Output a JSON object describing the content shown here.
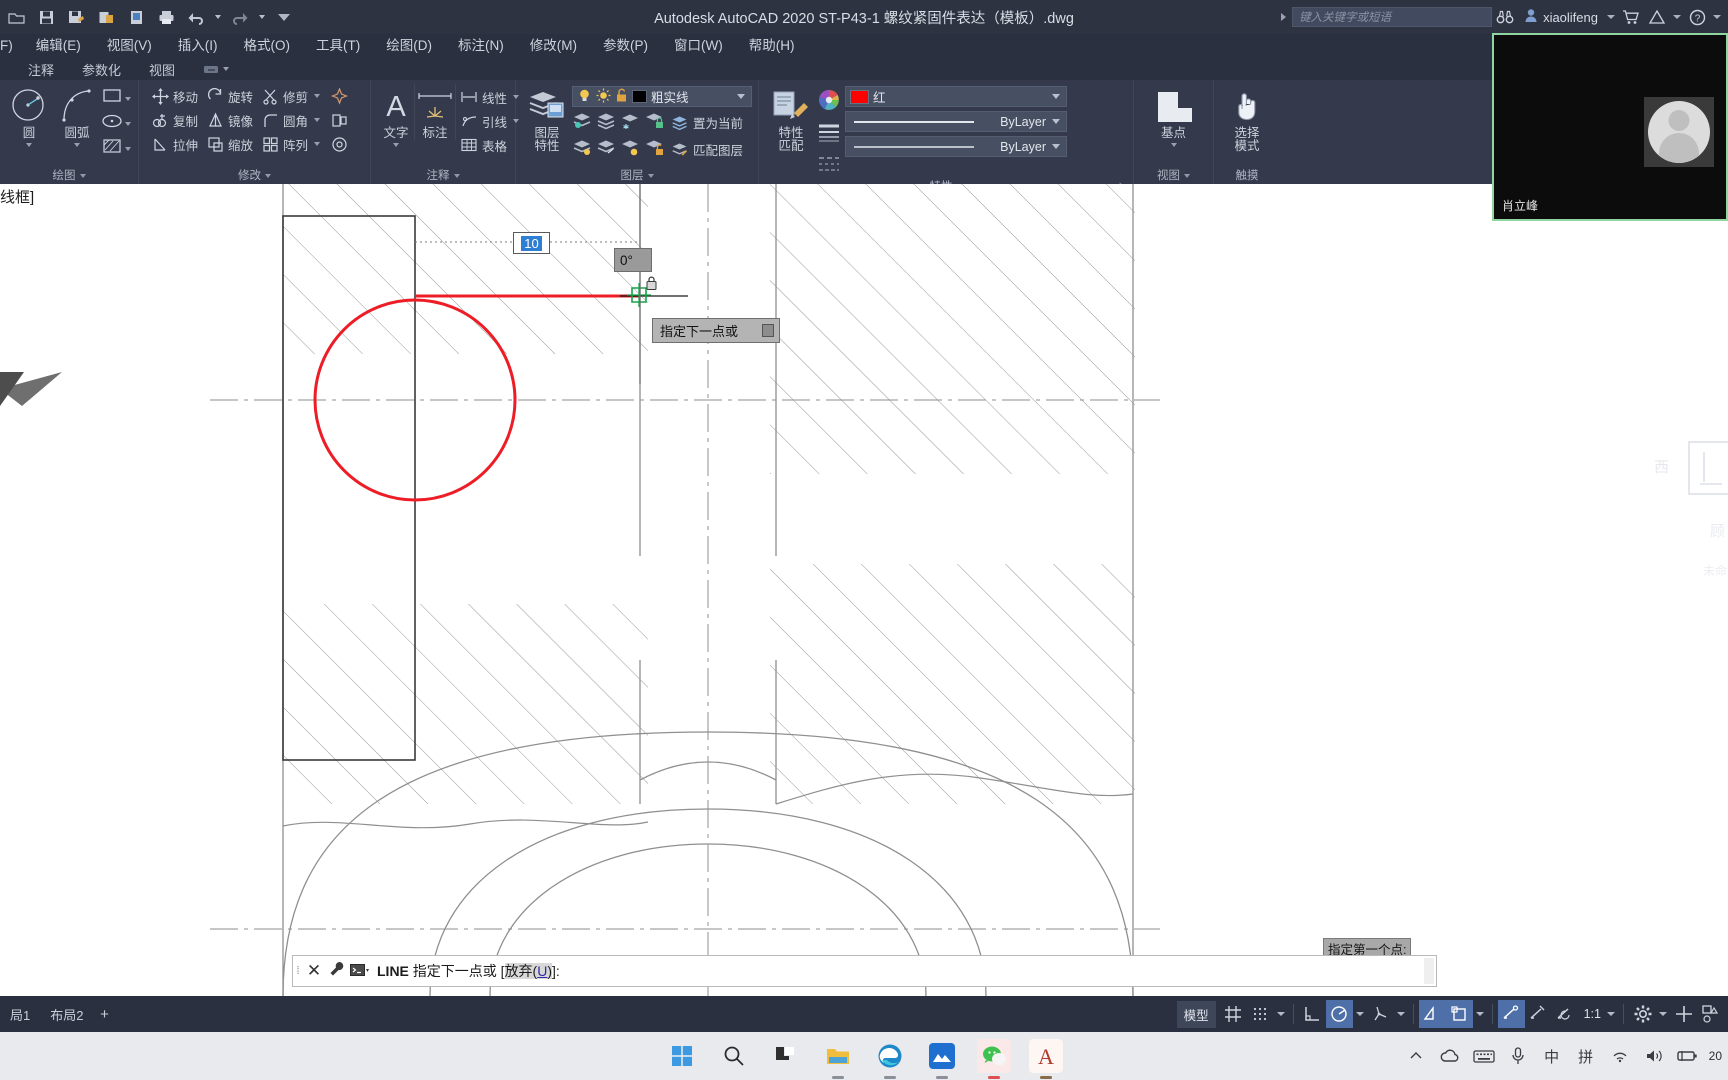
{
  "window": {
    "title": "Autodesk AutoCAD 2020   ST-P43-1 螺纹紧固件表达（模板）.dwg",
    "app": "Autodesk AutoCAD 2020",
    "document": "ST-P43-1 螺纹紧固件表达（模板）.dwg"
  },
  "quick_access": {
    "icons": [
      "open-icon",
      "save-icon",
      "save-as-icon",
      "export-icon",
      "plot-preview-icon",
      "print-icon",
      "undo-icon",
      "redo-icon",
      "customize-icon"
    ]
  },
  "titlebar_right": {
    "search_placeholder": "键入关键字或短语",
    "search_icon": "binoculars-icon",
    "user": "xiaolifeng",
    "user_icon": "user-icon",
    "cart_icon": "cart-icon",
    "share_icon": "share-icon",
    "help_icon": "help-icon"
  },
  "menubar": {
    "items": [
      {
        "label": "F)"
      },
      {
        "label": "编辑(E)"
      },
      {
        "label": "视图(V)"
      },
      {
        "label": "插入(I)"
      },
      {
        "label": "格式(O)"
      },
      {
        "label": "工具(T)"
      },
      {
        "label": "绘图(D)"
      },
      {
        "label": "标注(N)"
      },
      {
        "label": "修改(M)"
      },
      {
        "label": "参数(P)"
      },
      {
        "label": "窗口(W)"
      },
      {
        "label": "帮助(H)"
      }
    ]
  },
  "ribbon_tabs": {
    "items": [
      {
        "label": "​"
      },
      {
        "label": "注释"
      },
      {
        "label": "参数化"
      },
      {
        "label": "视图"
      }
    ]
  },
  "ribbon": {
    "panels": [
      {
        "name": "绘图",
        "label": "绘图",
        "big_buttons": [
          {
            "label": "圆",
            "icon": "circle-icon"
          },
          {
            "label": "圆弧",
            "icon": "arc-icon"
          }
        ],
        "small_buttons": [
          {
            "label": "",
            "icon": "rectangle-icon"
          },
          {
            "label": "",
            "icon": "ellipse-icon"
          },
          {
            "label": "",
            "icon": "hatch-icon"
          }
        ]
      },
      {
        "name": "修改",
        "label": "修改",
        "items": [
          {
            "label": "移动",
            "icon": "move-icon"
          },
          {
            "label": "旋转",
            "icon": "rotate-icon"
          },
          {
            "label": "修剪",
            "icon": "trim-icon"
          },
          {
            "label": "复制",
            "icon": "copy-icon"
          },
          {
            "label": "镜像",
            "icon": "mirror-icon"
          },
          {
            "label": "圆角",
            "icon": "fillet-icon"
          },
          {
            "label": "拉伸",
            "icon": "stretch-icon"
          },
          {
            "label": "缩放",
            "icon": "scale-icon"
          },
          {
            "label": "阵列",
            "icon": "array-icon"
          }
        ],
        "extra_icons": [
          "explode-icon",
          "offset-icon",
          "break-icon"
        ]
      },
      {
        "name": "注释",
        "label": "注释",
        "big_buttons": [
          {
            "label": "文字",
            "icon": "text-icon"
          },
          {
            "label": "标注",
            "icon": "dimension-icon"
          }
        ],
        "small_buttons": [
          {
            "label": "线性",
            "icon": "linear-dim-icon"
          },
          {
            "label": "引线",
            "icon": "leader-icon"
          },
          {
            "label": "表格",
            "icon": "table-icon"
          }
        ]
      },
      {
        "name": "图层",
        "label": "图层",
        "big_button": {
          "label_line1": "图层",
          "label_line2": "特性",
          "icon": "layer-properties-icon"
        },
        "current_layer": "粗实线",
        "layer_state_icons": [
          "lightbulb-on-icon",
          "sun-icon",
          "unlock-icon"
        ],
        "layer_color_swatch": "#000000",
        "actions": [
          {
            "label": "置为当前",
            "icon": "set-current-layer-icon"
          },
          {
            "label": "匹配图层",
            "icon": "match-layer-icon"
          }
        ],
        "row_icons_top": [
          "layer-isolate-icon",
          "layer-off-icon",
          "layer-freeze-icon",
          "layer-lock-icon"
        ],
        "row_icons_bottom": [
          "layer-unisolate-icon",
          "layer-on-icon",
          "layer-thaw-icon",
          "layer-unlock-icon"
        ]
      },
      {
        "name": "特性",
        "label": "特性",
        "big_button": {
          "label_line1": "特性",
          "label_line2": "匹配",
          "icon": "match-properties-icon"
        },
        "color": {
          "swatch": "#ff0000",
          "label": "红"
        },
        "linewidth": "ByLayer",
        "linetype": "ByLayer",
        "icons": [
          "color-wheel-icon",
          "linewidth-icon",
          "linetype-icon"
        ]
      },
      {
        "name": "视图",
        "label": "视图",
        "big_button": {
          "label": "基点",
          "icon": "base-point-icon"
        }
      },
      {
        "name": "触摸",
        "label": "触摸",
        "big_button": {
          "label_line1": "选择",
          "label_line2": "模式",
          "icon": "hand-pointer-icon"
        }
      }
    ]
  },
  "canvas": {
    "viewport_label": "线框]",
    "accent_color": "#ee1c25",
    "dynamic_input": {
      "length_value": "10",
      "angle_value": "0°",
      "lock_icon": "lock-icon",
      "prompt": "指定下一点或",
      "prompt_icon": "down-arrow-icon",
      "first_point_prompt": "指定第一个点:"
    }
  },
  "command_line": {
    "close_icon": "close-icon",
    "wrench_icon": "wrench-icon",
    "prompt_icon": "command-prompt-icon",
    "command": "LINE",
    "text": " 指定下一点或 ",
    "bracket_open": "[",
    "option_label": "放弃(",
    "option_key": "U",
    "option_close": ")",
    "bracket_close": "]:"
  },
  "status_bar": {
    "layout_tabs": [
      "局1",
      "布局2"
    ],
    "add_layout_icon": "plus-icon",
    "model_label": "模型",
    "scale": "1:1",
    "toggles": [
      {
        "name": "grid-display-toggle",
        "icon": "grid-icon",
        "active": false
      },
      {
        "name": "snap-mode-toggle",
        "icon": "snap-icon",
        "active": false
      },
      {
        "name": "ortho-mode-toggle",
        "icon": "ortho-icon",
        "active": false
      },
      {
        "name": "polar-tracking-toggle",
        "icon": "polar-icon",
        "active": true
      },
      {
        "name": "isometric-draft-toggle",
        "icon": "isodraft-icon",
        "active": false
      },
      {
        "name": "object-snap-tracking-toggle",
        "icon": "osnap-track-icon",
        "active": true
      },
      {
        "name": "object-snap-toggle",
        "icon": "osnap-icon",
        "active": true
      },
      {
        "name": "lineweight-toggle",
        "icon": "lineweight-icon",
        "active": true
      },
      {
        "name": "transparency-toggle",
        "icon": "transparency-icon",
        "active": false
      },
      {
        "name": "selection-cycling-toggle",
        "icon": "selection-cycle-icon",
        "active": false
      },
      {
        "name": "annotation-visibility-toggle",
        "icon": "annotation-icon",
        "active": false
      }
    ],
    "right_icons": [
      "settings-gear-icon",
      "fullscreen-icon",
      "customization-icon"
    ]
  },
  "webcam": {
    "participant_name": "肖立峰",
    "border_color": "#8fd6a0",
    "avatar_icon": "user-avatar-icon"
  },
  "taskbar": {
    "apps": [
      {
        "name": "start-button",
        "icon": "windows-icon"
      },
      {
        "name": "search-button",
        "icon": "search-icon"
      },
      {
        "name": "task-view-button",
        "icon": "task-view-icon"
      },
      {
        "name": "file-explorer",
        "icon": "folder-icon"
      },
      {
        "name": "microsoft-edge",
        "icon": "edge-icon"
      },
      {
        "name": "blue-app",
        "icon": "mountain-icon"
      },
      {
        "name": "wechat",
        "icon": "wechat-icon"
      },
      {
        "name": "autocad",
        "icon": "autocad-icon"
      }
    ],
    "tray": [
      {
        "name": "show-hidden-icons",
        "icon": "chevron-up-icon"
      },
      {
        "name": "onedrive",
        "icon": "cloud-icon"
      },
      {
        "name": "touch-keyboard",
        "icon": "keyboard-icon"
      },
      {
        "name": "microphone",
        "icon": "mic-icon"
      },
      {
        "name": "ime-language",
        "icon": "chinese-char-icon",
        "label": "中"
      },
      {
        "name": "ime-pinyin",
        "icon": "pinyin-icon",
        "label": "拼"
      },
      {
        "name": "network",
        "icon": "wifi-icon"
      },
      {
        "name": "volume",
        "icon": "speaker-icon"
      },
      {
        "name": "battery",
        "icon": "battery-icon"
      }
    ],
    "clock": "20"
  },
  "right_palette": {
    "faint_labels": [
      "西",
      "顾",
      "未命"
    ]
  }
}
